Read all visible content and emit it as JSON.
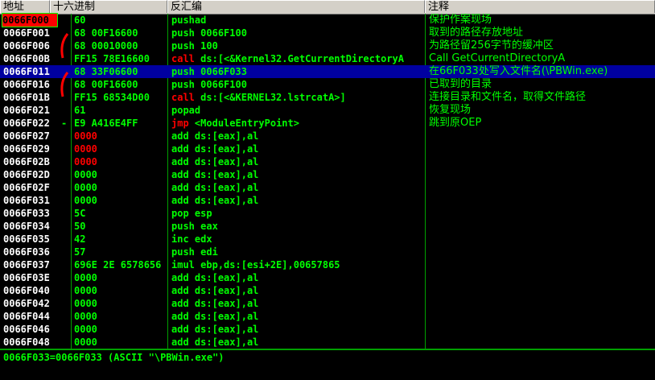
{
  "columns": {
    "address": "地址",
    "hex": "十六进制",
    "disasm": "反汇编",
    "comment": "注释"
  },
  "rows": [
    {
      "addr": "0066F000",
      "hex": "60",
      "mn": "pushad",
      "ops": "",
      "cmt": "保护作案现场"
    },
    {
      "addr": "0066F001",
      "hex": "68 00F16600",
      "mn": "push",
      "ops": "0066F100",
      "cmt": "取到的路径存放地址"
    },
    {
      "addr": "0066F006",
      "hex": "68 00010000",
      "mn": "push",
      "ops": "100",
      "cmt": "为路径留256字节的缓冲区"
    },
    {
      "addr": "0066F00B",
      "hex": "FF15 78E16600",
      "mn": "call",
      "ops": "ds:[<&Kernel32.GetCurrentDirectoryA",
      "cmt": "Call GetCurrentDirectoryA"
    },
    {
      "addr": "0066F011",
      "hex": "68 33F06600",
      "mn": "push",
      "ops": "0066F033",
      "cmt": "在66F033处写入文件名(\\PBWin.exe)"
    },
    {
      "addr": "0066F016",
      "hex": "68 00F16600",
      "mn": "push",
      "ops": "0066F100",
      "cmt": "已取到的目录"
    },
    {
      "addr": "0066F01B",
      "hex": "FF15 68534D00",
      "mn": "call",
      "ops": "ds:[<&KERNEL32.lstrcatA>]",
      "cmt": "连接目录和文件名，取得文件路径"
    },
    {
      "addr": "0066F021",
      "hex": "61",
      "mn": "popad",
      "ops": "",
      "cmt": "恢复现场"
    },
    {
      "addr": "0066F022",
      "hex": "E9 A416E4FF",
      "mn": "jmp",
      "ops": "<ModuleEntryPoint>",
      "cmt": "跳到原OEP"
    },
    {
      "addr": "0066F027",
      "hex": "0000",
      "mn": "add",
      "ops": "ds:[eax],al",
      "cmt": ""
    },
    {
      "addr": "0066F029",
      "hex": "0000",
      "mn": "add",
      "ops": "ds:[eax],al",
      "cmt": ""
    },
    {
      "addr": "0066F02B",
      "hex": "0000",
      "mn": "add",
      "ops": "ds:[eax],al",
      "cmt": ""
    },
    {
      "addr": "0066F02D",
      "hex": "0000",
      "mn": "add",
      "ops": "ds:[eax],al",
      "cmt": ""
    },
    {
      "addr": "0066F02F",
      "hex": "0000",
      "mn": "add",
      "ops": "ds:[eax],al",
      "cmt": ""
    },
    {
      "addr": "0066F031",
      "hex": "0000",
      "mn": "add",
      "ops": "ds:[eax],al",
      "cmt": ""
    },
    {
      "addr": "0066F033",
      "hex": "5C",
      "mn": "pop",
      "ops": "esp",
      "cmt": ""
    },
    {
      "addr": "0066F034",
      "hex": "50",
      "mn": "push",
      "ops": "eax",
      "cmt": ""
    },
    {
      "addr": "0066F035",
      "hex": "42",
      "mn": "inc",
      "ops": "edx",
      "cmt": ""
    },
    {
      "addr": "0066F036",
      "hex": "57",
      "mn": "push",
      "ops": "edi",
      "cmt": ""
    },
    {
      "addr": "0066F037",
      "hex": "696E 2E 6578656",
      "mn": "imul",
      "ops": "ebp,ds:[esi+2E],00657865",
      "cmt": ""
    },
    {
      "addr": "0066F03E",
      "hex": "0000",
      "mn": "add",
      "ops": "ds:[eax],al",
      "cmt": ""
    },
    {
      "addr": "0066F040",
      "hex": "0000",
      "mn": "add",
      "ops": "ds:[eax],al",
      "cmt": ""
    },
    {
      "addr": "0066F042",
      "hex": "0000",
      "mn": "add",
      "ops": "ds:[eax],al",
      "cmt": ""
    },
    {
      "addr": "0066F044",
      "hex": "0000",
      "mn": "add",
      "ops": "ds:[eax],al",
      "cmt": ""
    },
    {
      "addr": "0066F046",
      "hex": "0000",
      "mn": "add",
      "ops": "ds:[eax],al",
      "cmt": ""
    },
    {
      "addr": "0066F048",
      "hex": "0000",
      "mn": "add",
      "ops": "ds:[eax],al",
      "cmt": ""
    }
  ],
  "jump_marker": "-",
  "status_text": "0066F033=0066F033 (ASCII \"\\PBWin.exe\")",
  "colors": {
    "background": "#000000",
    "selected_row": "#0000a0",
    "address_highlight": "#ff0000",
    "text": "#00ff00",
    "call_jmp": "#ff0000",
    "header": "#d4d0c8"
  }
}
